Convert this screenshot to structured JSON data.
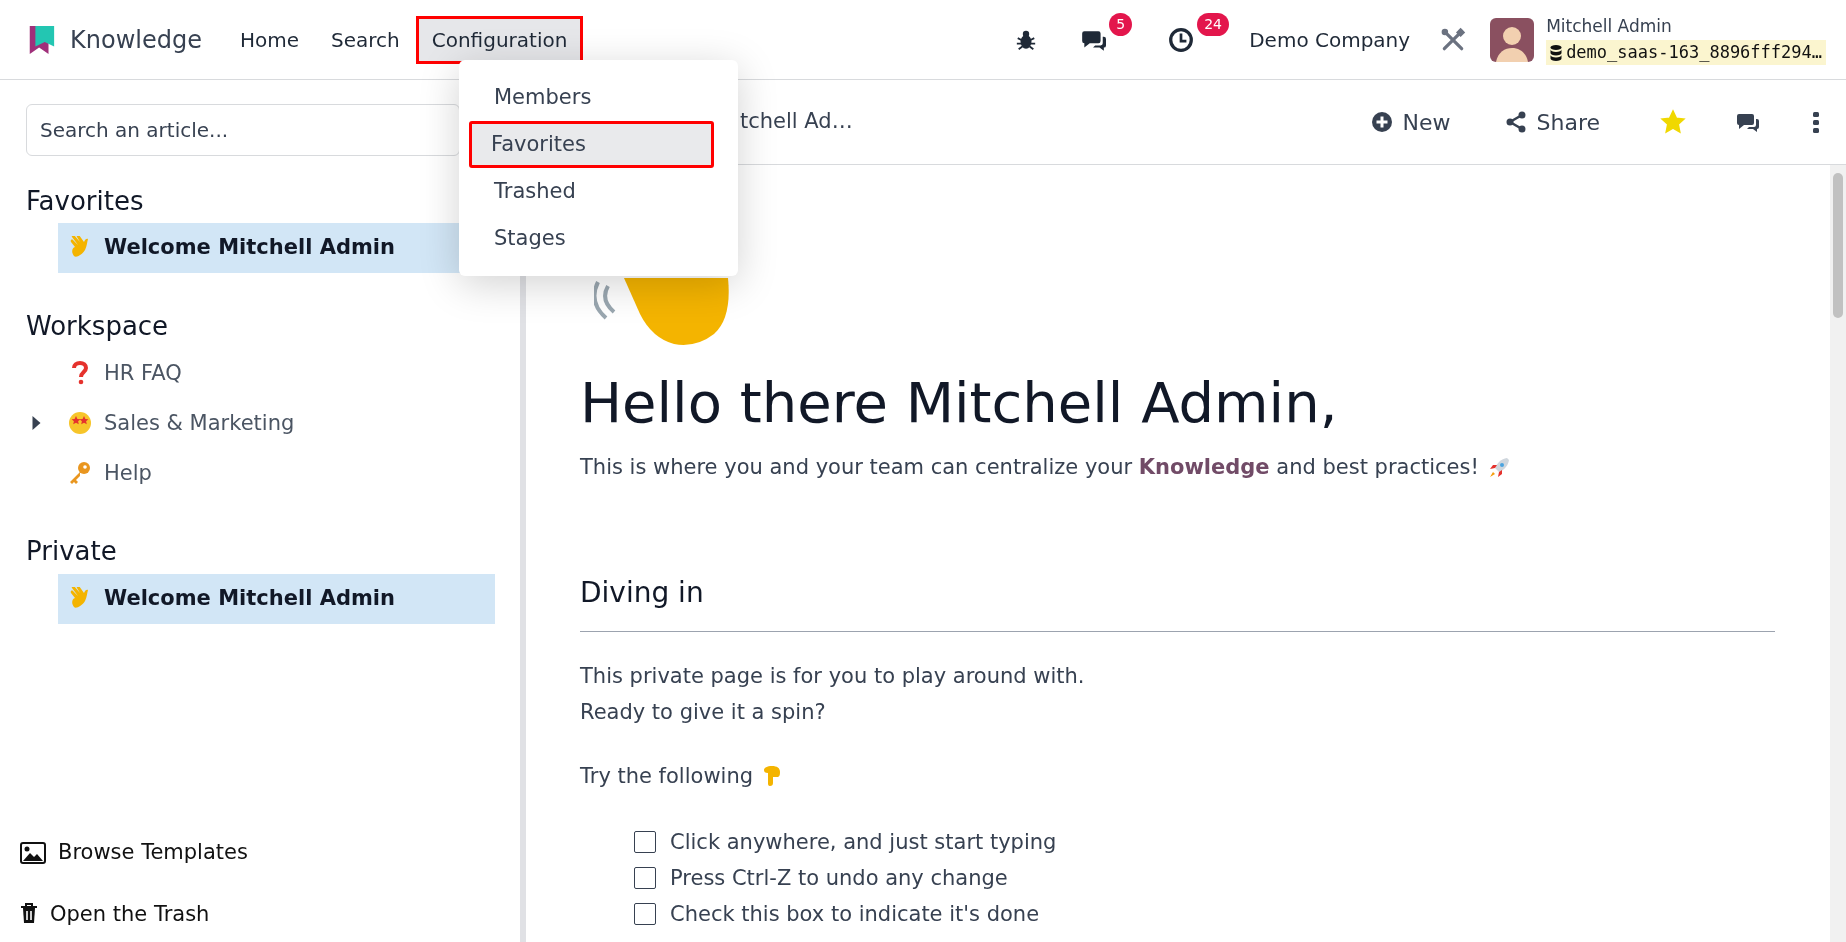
{
  "navbar": {
    "app_name": "Knowledge",
    "menu": [
      {
        "label": "Home",
        "highlighted": false,
        "expanded": false
      },
      {
        "label": "Search",
        "highlighted": false,
        "expanded": false
      },
      {
        "label": "Configuration",
        "highlighted": true,
        "expanded": true
      }
    ],
    "messages_badge": "5",
    "activities_badge": "24",
    "company": "Demo Company",
    "user": {
      "name": "Mitchell Admin",
      "database": "demo_saas-163_8896fff294…"
    }
  },
  "dropdown": {
    "items": [
      {
        "label": "Members",
        "selected": false,
        "highlighted": false
      },
      {
        "label": "Favorites",
        "selected": true,
        "highlighted": true
      },
      {
        "label": "Trashed",
        "selected": false,
        "highlighted": false
      },
      {
        "label": "Stages",
        "selected": false,
        "highlighted": false
      }
    ]
  },
  "sidebar": {
    "search": {
      "placeholder": "Search an article..."
    },
    "sections": [
      {
        "title": "Favorites",
        "items": [
          {
            "label": "Welcome Mitchell Admin",
            "selected": true
          }
        ]
      },
      {
        "title": "Workspace",
        "items": [
          {
            "label": "HR FAQ",
            "selected": false
          },
          {
            "label": "Sales & Marketing",
            "selected": false,
            "expanded": false
          },
          {
            "label": "Help",
            "selected": false
          }
        ]
      },
      {
        "title": "Private",
        "items": [
          {
            "label": "Welcome Mitchell Admin",
            "selected": true
          }
        ]
      }
    ],
    "footer": [
      "Browse Templates",
      "Open the Trash"
    ]
  },
  "article": {
    "breadcrumb": "tchell Ad…",
    "actions": [
      "New",
      "Share"
    ],
    "favorite": true,
    "title": "Hello there Mitchell Admin,",
    "intro": "This is where you and your team can centralize your **Knowledge** and best practices!",
    "heading": "Diving in",
    "lines": [
      "This private page is for you to play around with.",
      "Ready to give it a spin?"
    ],
    "try_text": "Try the following",
    "checklist": [
      {
        "label": "Click anywhere, and just start typing",
        "checked": false
      },
      {
        "label": "Press Ctrl-Z to undo any change",
        "checked": false
      },
      {
        "label": "Check this box to indicate it's done",
        "checked": false
      }
    ]
  }
}
